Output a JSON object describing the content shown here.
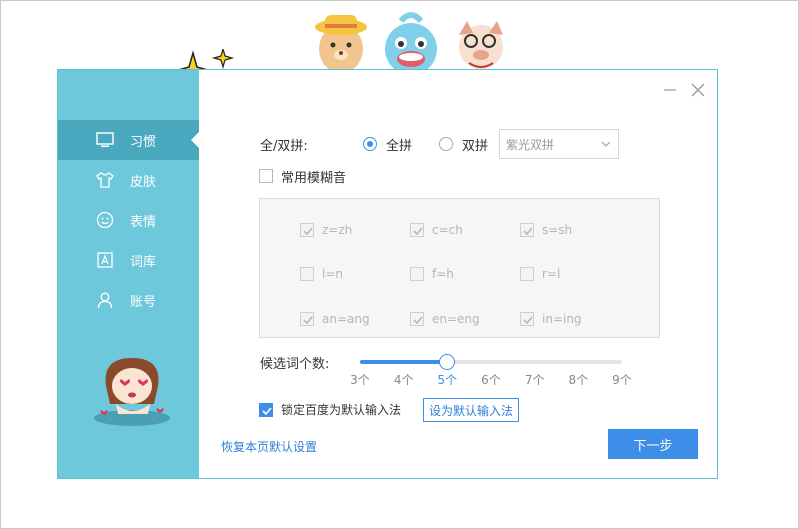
{
  "sidebar": {
    "items": [
      {
        "label": "习惯",
        "icon": "monitor-icon",
        "active": true
      },
      {
        "label": "皮肤",
        "icon": "shirt-icon",
        "active": false
      },
      {
        "label": "表情",
        "icon": "smiley-icon",
        "active": false
      },
      {
        "label": "词库",
        "icon": "dictionary-icon",
        "active": false
      },
      {
        "label": "账号",
        "icon": "user-icon",
        "active": false
      }
    ]
  },
  "pinyin": {
    "label": "全/双拼:",
    "full_label": "全拼",
    "double_label": "双拼",
    "selected": "全拼",
    "scheme_value": "紫光双拼"
  },
  "fuzzy": {
    "label": "常用模糊音",
    "checked": false,
    "options": [
      {
        "text": "z=zh",
        "checked": true
      },
      {
        "text": "c=ch",
        "checked": true
      },
      {
        "text": "s=sh",
        "checked": true
      },
      {
        "text": "l=n",
        "checked": false
      },
      {
        "text": "f=h",
        "checked": false
      },
      {
        "text": "r=l",
        "checked": false
      },
      {
        "text": "an=ang",
        "checked": true
      },
      {
        "text": "en=eng",
        "checked": true
      },
      {
        "text": "in=ing",
        "checked": true
      }
    ]
  },
  "candidates": {
    "label": "候选词个数:",
    "ticks": [
      "3个",
      "4个",
      "5个",
      "6个",
      "7个",
      "8个",
      "9个"
    ],
    "value": 5,
    "min": 3,
    "max": 9
  },
  "default_ime": {
    "checkbox_label": "锁定百度为默认输入法",
    "checked": true,
    "button_label": "设为默认输入法"
  },
  "footer": {
    "restore_label": "恢复本页默认设置",
    "next_label": "下一步"
  },
  "colors": {
    "accent": "#3d8ee8",
    "sidebar": "#6ec8dc",
    "sidebar_active": "#4aa9bf"
  }
}
